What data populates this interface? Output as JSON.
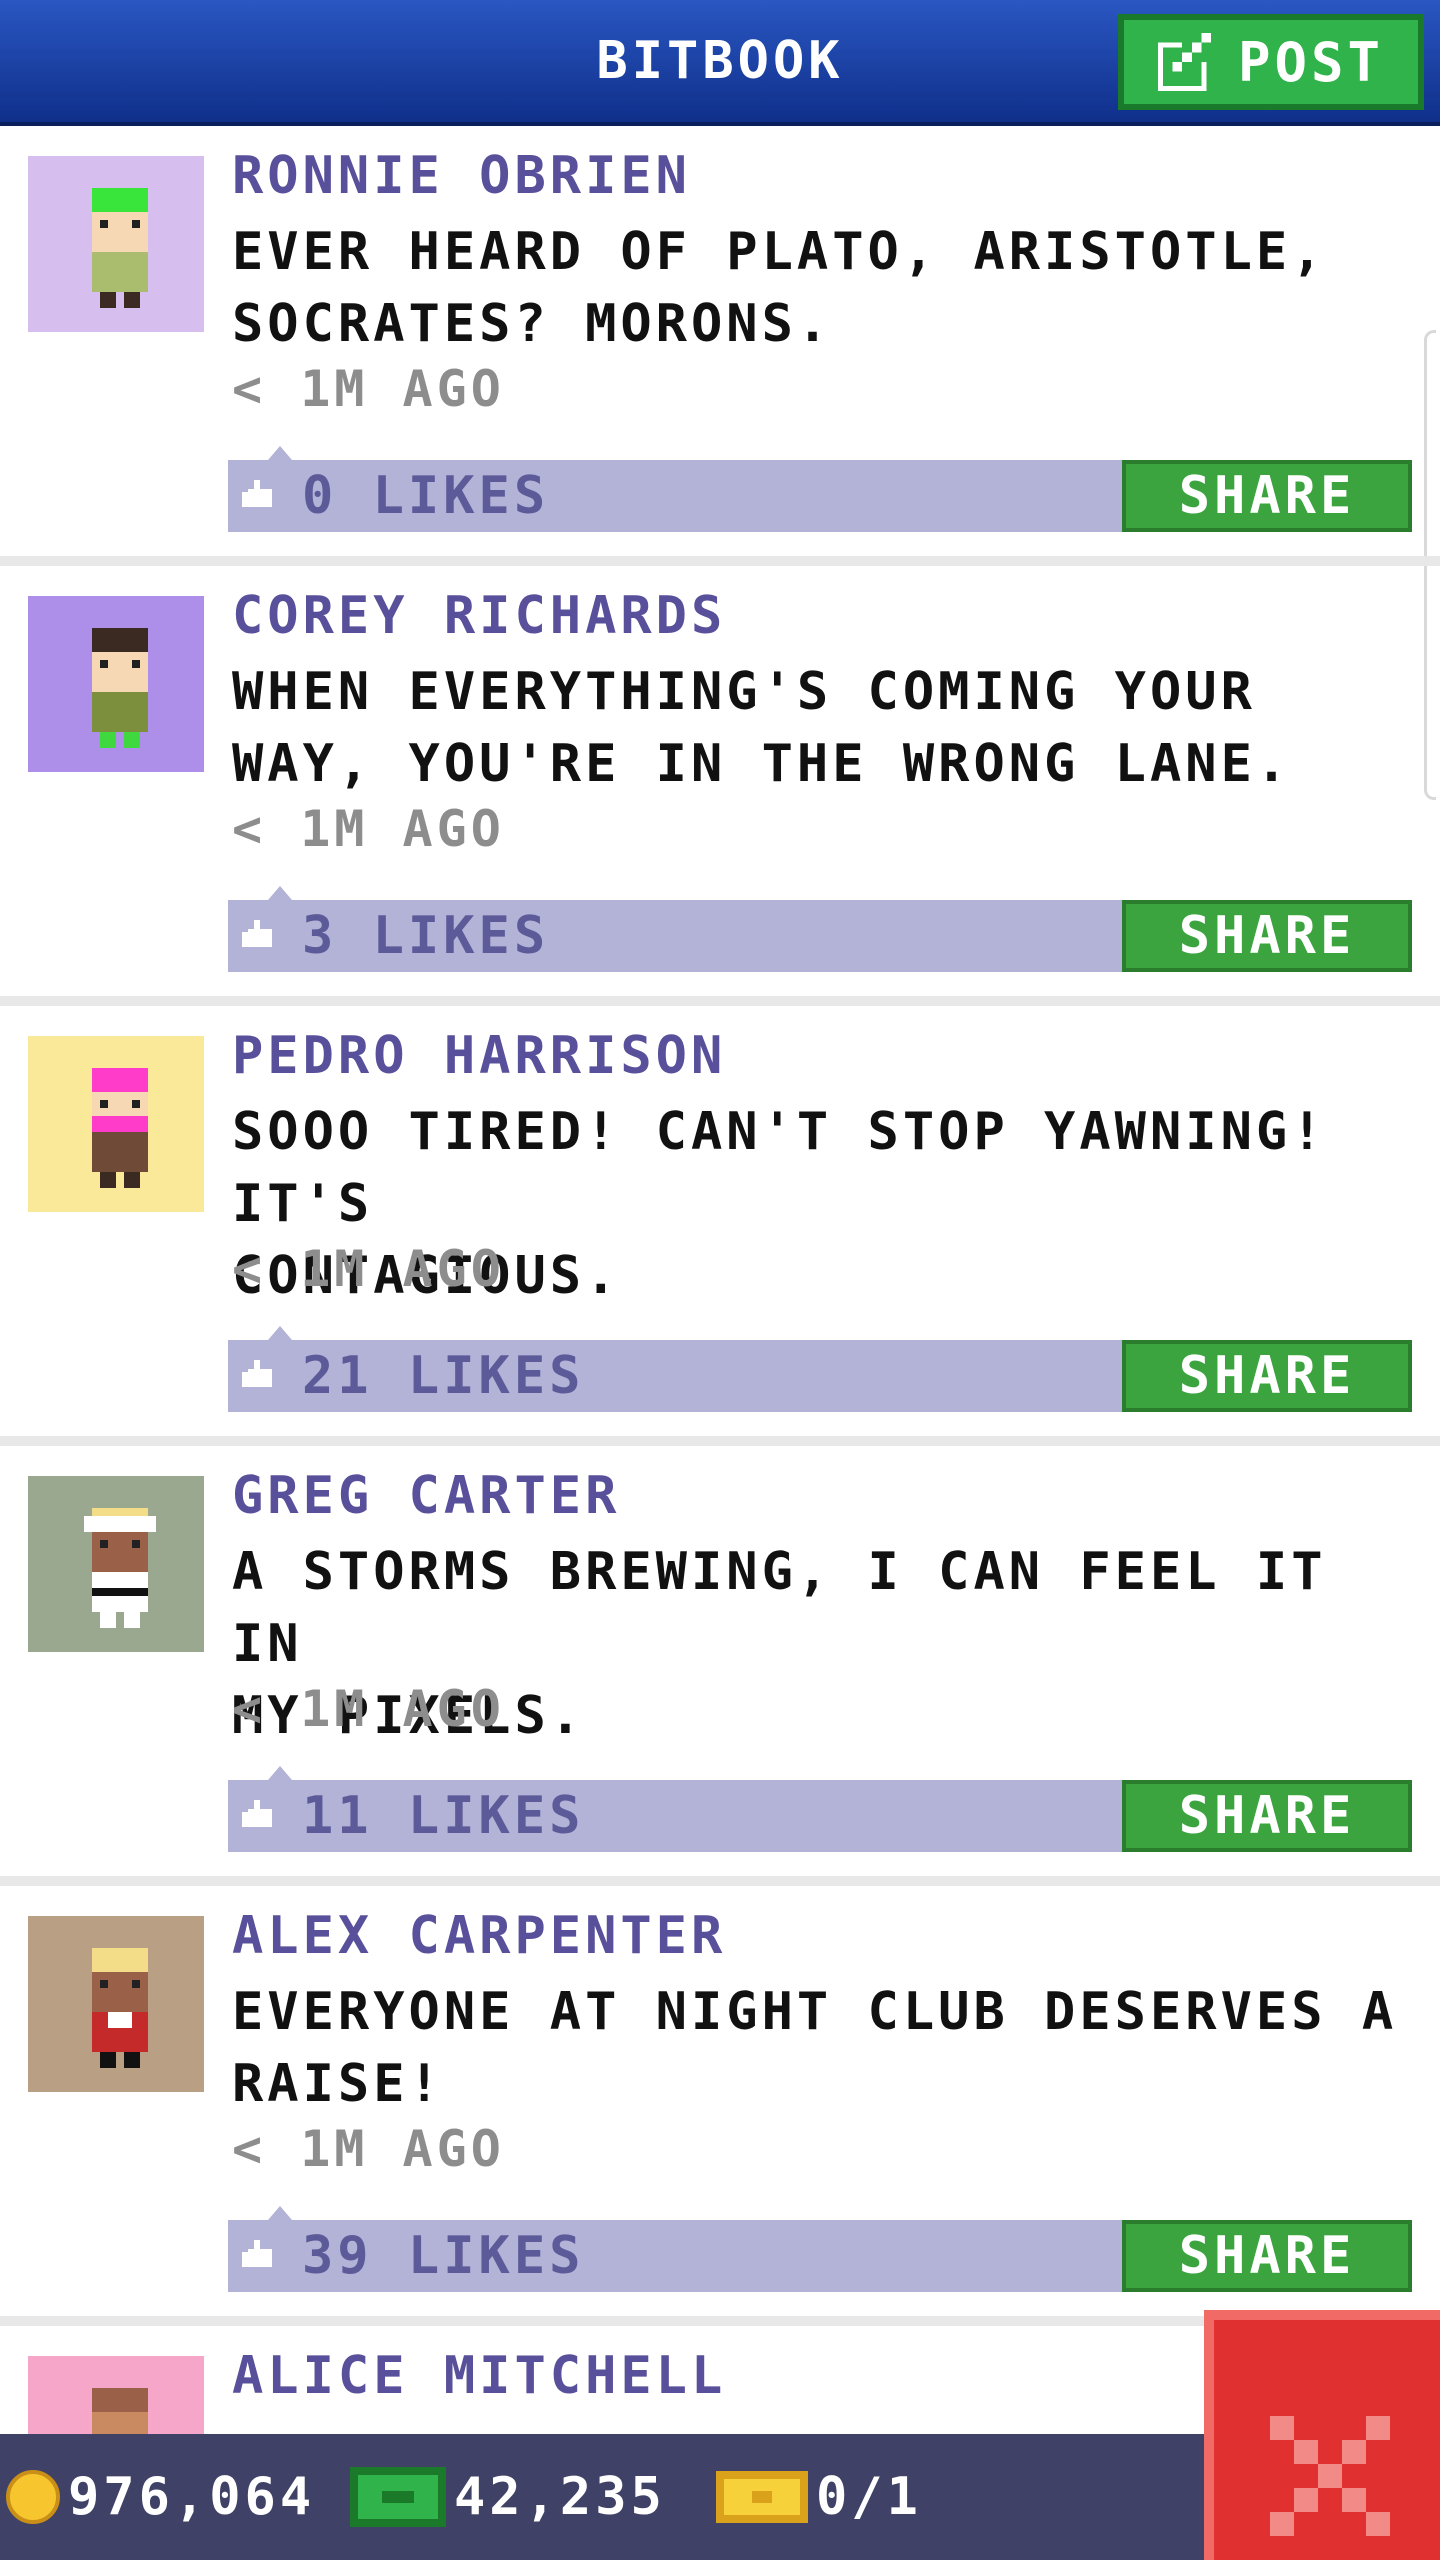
{
  "header": {
    "title": "BITBOOK",
    "post_label": "POST"
  },
  "posts": [
    {
      "name": "RONNIE OBRIEN",
      "message": "EVER HEARD OF PLATO, ARISTOTLE,\nSOCRATES? MORONS.",
      "time": "< 1M AGO",
      "likes": "0 LIKES",
      "share_label": "SHARE",
      "avatar_bg": "#d6bfee",
      "hair": "#39e53a",
      "skin": "#f7d8b5",
      "shirt": "#aabc6e"
    },
    {
      "name": "COREY RICHARDS",
      "message": "WHEN EVERYTHING'S COMING YOUR\nWAY, YOU'RE IN THE WRONG LANE.",
      "time": "< 1M AGO",
      "likes": "3 LIKES",
      "share_label": "SHARE",
      "avatar_bg": "#ad8ee8",
      "hair": "#3a2a22",
      "skin": "#f7d8b5",
      "shirt": "#7c8f3c"
    },
    {
      "name": "PEDRO HARRISON",
      "message": "SOOO TIRED! CAN'T STOP YAWNING! IT'S\nCONTAGIOUS.",
      "time": "< 1M AGO",
      "likes": "21 LIKES",
      "share_label": "SHARE",
      "avatar_bg": "#fbe99a",
      "hair": "#ff3cc9",
      "skin": "#f7d8b5",
      "shirt": "#6f4a36"
    },
    {
      "name": "GREG CARTER",
      "message": "A STORMS BREWING, I CAN FEEL IT IN\nMY PIXELS.",
      "time": "< 1M AGO",
      "likes": "11 LIKES",
      "share_label": "SHARE",
      "avatar_bg": "#9aa890",
      "hair": "#ffffff",
      "skin": "#9b6148",
      "shirt": "#ffffff"
    },
    {
      "name": "ALEX CARPENTER",
      "message": "EVERYONE AT NIGHT CLUB DESERVES A\nRAISE!",
      "time": "< 1M AGO",
      "likes": "39 LIKES",
      "share_label": "SHARE",
      "avatar_bg": "#b9a085",
      "hair": "#f3dd88",
      "skin": "#9b6148",
      "shirt": "#c42a2a"
    }
  ],
  "partial_post": {
    "name": "ALICE MITCHELL",
    "avatar_bg": "#f6a6c8",
    "hair": "#9b6148",
    "skin": "#c98a62"
  },
  "bottom_bar": {
    "coins": "976,064",
    "bux": "42,235",
    "tickets": "0/1"
  },
  "colors": {
    "header": "#1d44a8",
    "share": "#3ba43f",
    "like_bar": "#b2b3d6",
    "name": "#58509a",
    "close": "#e0302f"
  }
}
